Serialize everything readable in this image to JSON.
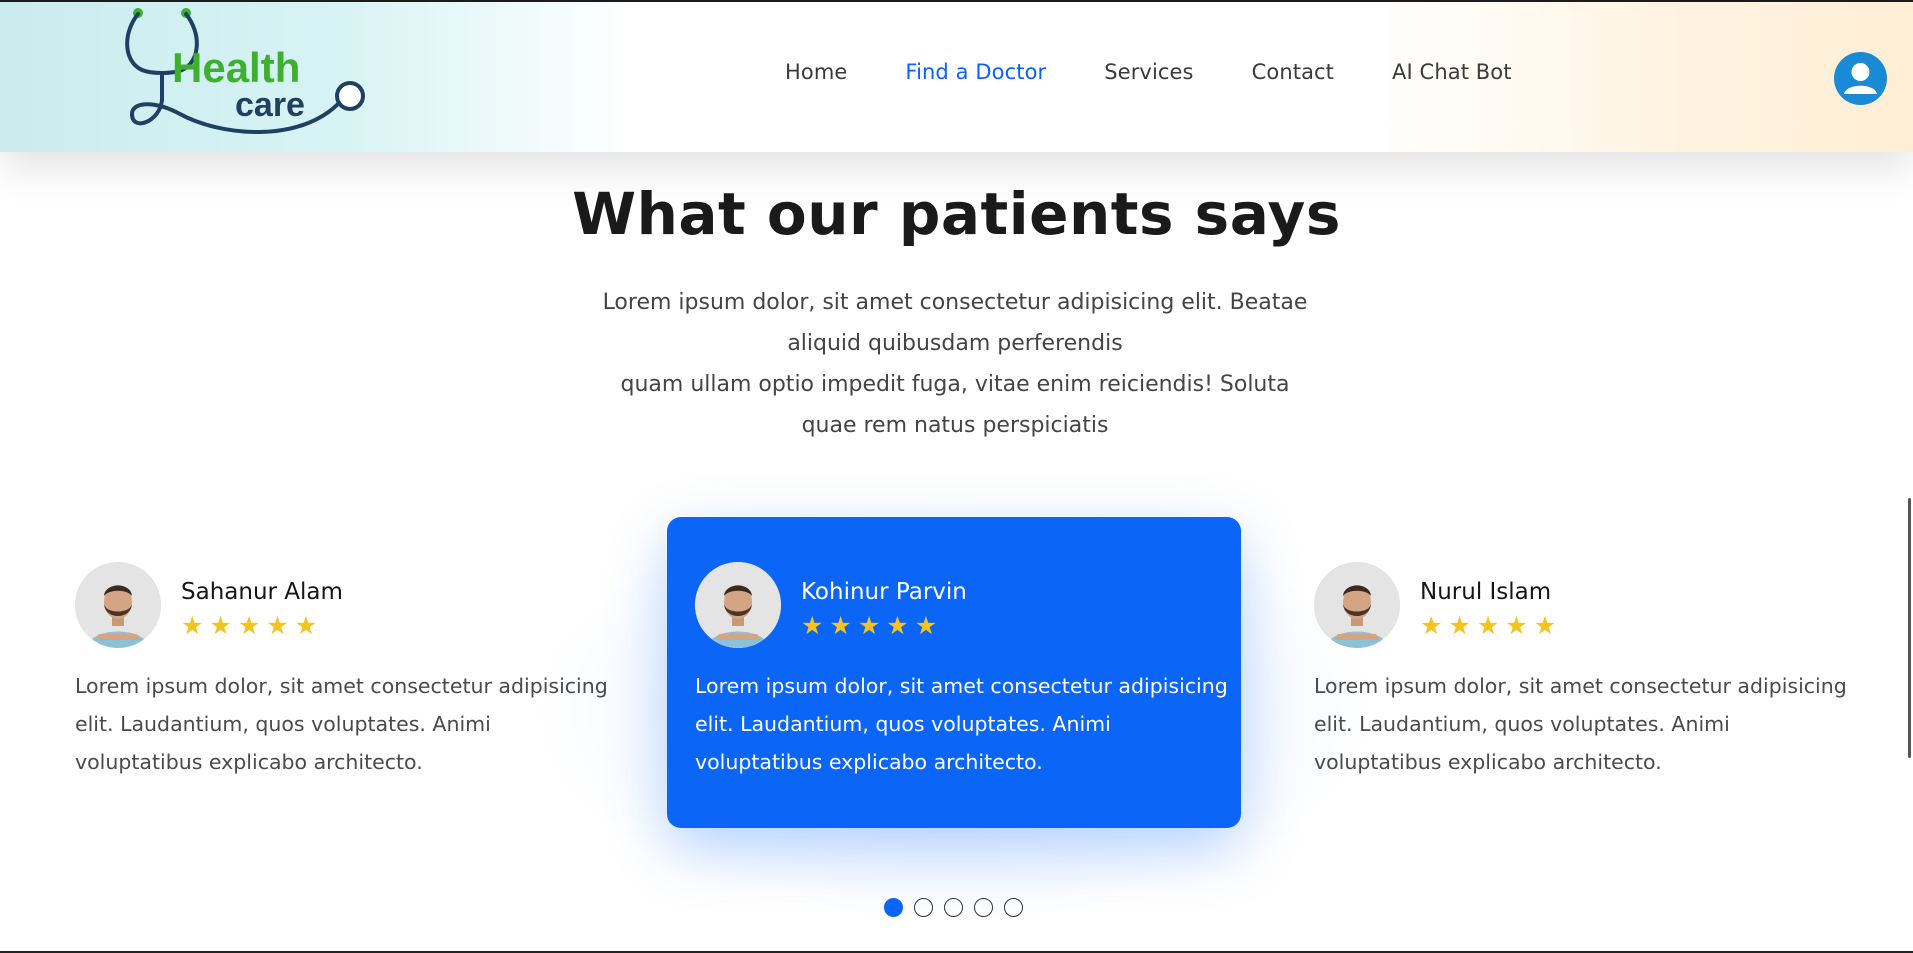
{
  "brand": {
    "logo_word1": "Health",
    "logo_word2": "care",
    "colors": {
      "green": "#3db02f",
      "navy": "#1f3f63"
    }
  },
  "nav": {
    "items": [
      {
        "label": "Home",
        "active": false
      },
      {
        "label": "Find a Doctor",
        "active": true
      },
      {
        "label": "Services",
        "active": false
      },
      {
        "label": "Contact",
        "active": false
      },
      {
        "label": "AI Chat Bot",
        "active": false
      }
    ],
    "active_color": "#0b62f4",
    "profile_icon": "user-icon"
  },
  "section": {
    "title": "What our patients says",
    "description_line1": "Lorem ipsum dolor, sit amet consectetur adipisicing elit. Beatae aliquid quibusdam perferendis",
    "description_line2": "quam ullam optio impedit fuga, vitae enim reiciendis! Soluta quae rem natus perspiciatis"
  },
  "testimonials": [
    {
      "name": "Sahanur Alam",
      "rating": 5,
      "text": "Lorem ipsum dolor, sit amet consectetur adipisicing elit. Laudantium, quos voluptates. Animi voluptatibus explicabo architecto."
    },
    {
      "name": "Kohinur Parvin",
      "rating": 5,
      "text": "Lorem ipsum dolor, sit amet consectetur adipisicing elit. Laudantium, quos voluptates. Animi voluptatibus explicabo architecto."
    },
    {
      "name": "Nurul Islam",
      "rating": 5,
      "text": "Lorem ipsum dolor, sit amet consectetur adipisicing elit. Laudantium, quos voluptates. Animi voluptatibus explicabo architecto."
    }
  ],
  "featured_color": "#0b66f7",
  "star_color": "#f5c320",
  "pagination": {
    "total": 5,
    "active_index": 0
  }
}
